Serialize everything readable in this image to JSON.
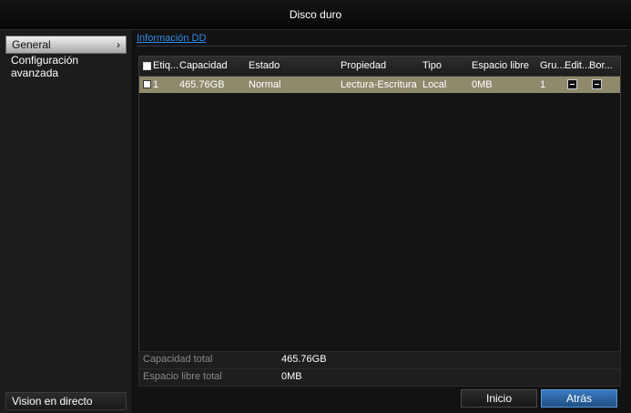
{
  "window": {
    "title": "Disco duro"
  },
  "sidebar": {
    "items": [
      {
        "label": "General",
        "active": true,
        "chevron": "›"
      },
      {
        "label": "Configuración avanzada",
        "active": false
      }
    ],
    "bottom_label": "Vision en directo"
  },
  "tab": {
    "label": "Información DD"
  },
  "table": {
    "headers": [
      "Etiq...",
      "Capacidad",
      "Estado",
      "Propiedad",
      "Tipo",
      "Espacio libre",
      "Gru...",
      "Edit...",
      "Bor..."
    ],
    "rows": [
      {
        "label": "1",
        "capacity": "465.76GB",
        "status": "Normal",
        "property": "Lectura-Escritura",
        "type": "Local",
        "free": "0MB",
        "group": "1",
        "edit_icon": "edit-icon",
        "delete_icon": "delete-icon"
      }
    ]
  },
  "summary": {
    "total_label": "Capacidad total",
    "total_value": "465.76GB",
    "free_label": "Espacio libre total",
    "free_value": "0MB"
  },
  "buttons": {
    "home": "Inicio",
    "back": "Atrás"
  },
  "colors": {
    "accent": "#2e8ce6",
    "selected_row": "#8f8a6c",
    "back_button": "#2b64a2"
  }
}
